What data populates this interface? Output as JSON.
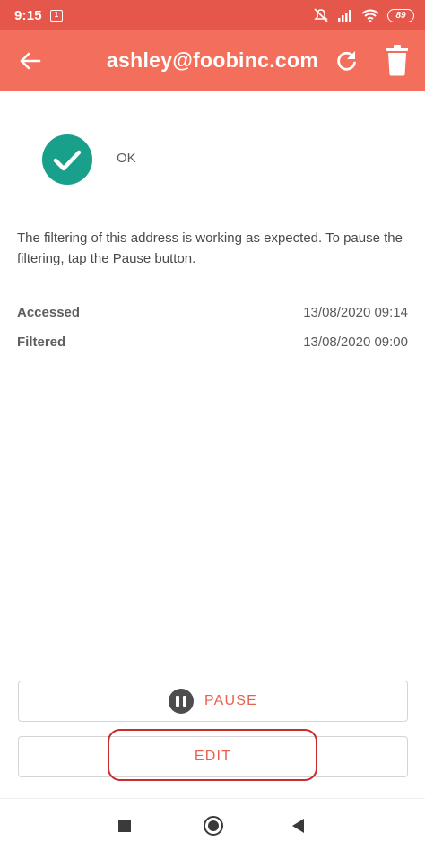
{
  "status_bar": {
    "time": "9:15",
    "notification_badge": "1",
    "battery": "89",
    "icons": [
      "silent-icon",
      "signal-icon",
      "wifi-icon",
      "battery-icon"
    ]
  },
  "app_bar": {
    "title": "ashley@foobinc.com",
    "back_icon": "arrow-left-icon",
    "refresh_icon": "refresh-icon",
    "delete_icon": "trash-icon",
    "color": "#f36f5b"
  },
  "status": {
    "label": "OK",
    "icon": "check-circle-icon",
    "color": "#19a08b"
  },
  "description": "The filtering of this address is working as expected. To pause the filtering, tap the Pause button.",
  "info": [
    {
      "label": "Accessed",
      "value": "13/08/2020 09:14"
    },
    {
      "label": "Filtered",
      "value": "13/08/2020 09:00"
    }
  ],
  "buttons": {
    "pause_label": "PAUSE",
    "edit_label": "EDIT",
    "accent": "#e8604f"
  },
  "nav": {
    "icons": [
      "recents-square-icon",
      "home-circle-icon",
      "back-triangle-icon"
    ]
  }
}
